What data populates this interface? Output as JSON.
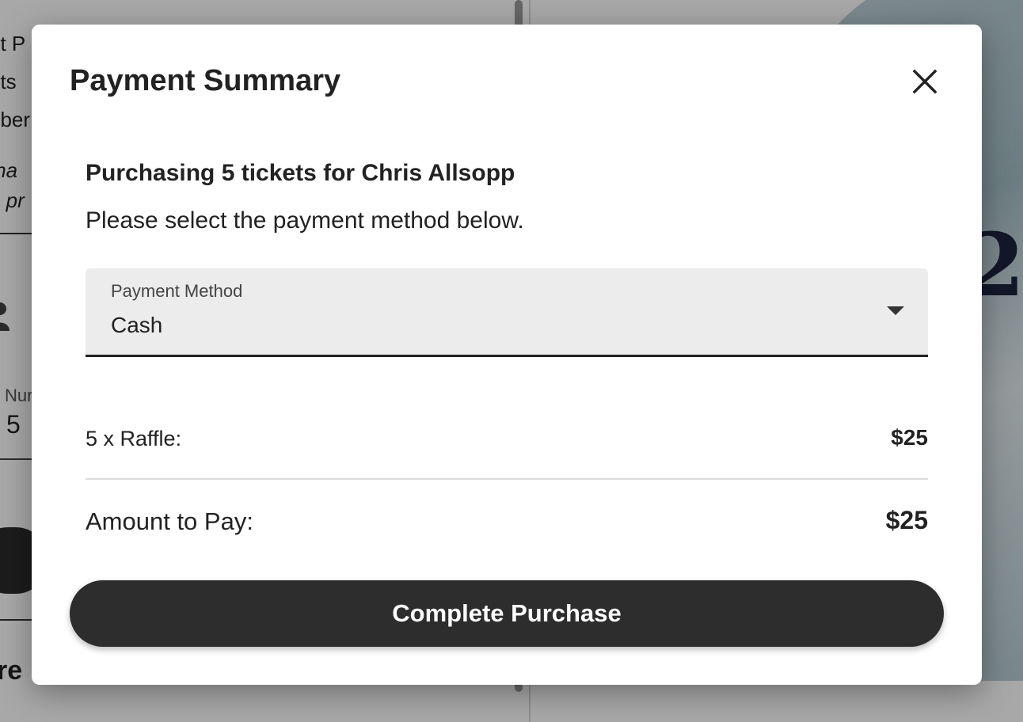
{
  "background": {
    "left_lines": [
      "et P",
      "ets",
      "nber"
    ],
    "italic_lines": [
      "tha",
      "e pr"
    ],
    "field_label": "Nur",
    "field_value": "5",
    "heading": "re"
  },
  "modal": {
    "title": "Payment Summary",
    "close_icon": "close-icon",
    "subtitle": "Purchasing 5 tickets for Chris Allsopp",
    "instructions": "Please select the payment method below.",
    "payment_method": {
      "label": "Payment Method",
      "selected": "Cash"
    },
    "line_items": [
      {
        "label": "5 x Raffle:",
        "amount": "$25"
      }
    ],
    "total": {
      "label": "Amount to Pay:",
      "amount": "$25"
    },
    "complete_button": "Complete Purchase"
  },
  "colors": {
    "button_bg": "#2d2d2d",
    "select_bg": "#ececec",
    "text": "#222222"
  }
}
